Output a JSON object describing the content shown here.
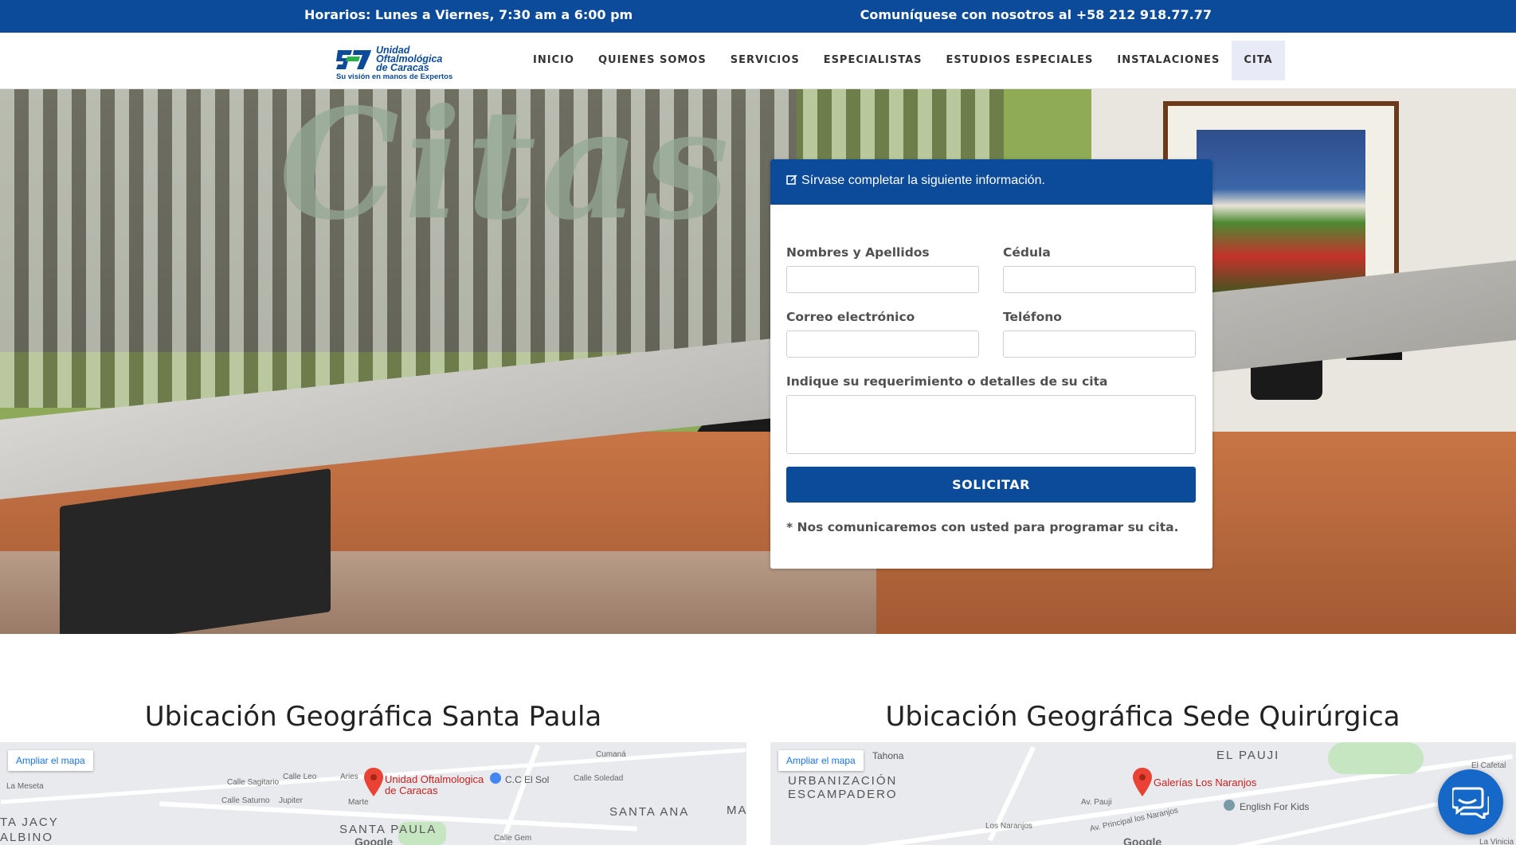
{
  "topbar": {
    "hours": "Horarios: Lunes a Viernes, 7:30 am a 6:00 pm",
    "contact": "Comuníquese con nosotros al +58 212 918.77.77"
  },
  "logo": {
    "line1": "Unidad",
    "line2": "Oftalmológica",
    "line3": "de Caracas",
    "tagline": "Su visión en manos de Expertos"
  },
  "nav": {
    "items": [
      {
        "label": "INICIO"
      },
      {
        "label": "QUIENES SOMOS"
      },
      {
        "label": "SERVICIOS"
      },
      {
        "label": "ESPECIALISTAS"
      },
      {
        "label": "ESTUDIOS ESPECIALES"
      },
      {
        "label": "INSTALACIONES"
      },
      {
        "label": "CITA",
        "active": true
      }
    ]
  },
  "hero": {
    "sign_text": "Citas"
  },
  "form": {
    "header": "Sírvase completar la siguiente información.",
    "name_label": "Nombres y Apellidos",
    "name_value": "",
    "id_label": "Cédula",
    "id_value": "",
    "email_label": "Correo electrónico",
    "email_value": "",
    "phone_label": "Teléfono",
    "phone_value": "",
    "details_label": "Indique su requerimiento o detalles de su cita",
    "details_value": "",
    "submit_label": "SOLICITAR",
    "note": "* Nos comunicaremos con usted para programar su cita."
  },
  "locations": [
    {
      "title": "Ubicación Geográfica Santa Paula",
      "enlarge_label": "Ampliar el mapa",
      "place_label": "Unidad Oftalmologica de Caracas",
      "poi": "C.C El Sol",
      "areas": [
        "SANTA PAULA",
        "SANTA ANA",
        "TA JACY",
        "ALBINO",
        "MA"
      ],
      "streets": [
        "La Meseta",
        "Calle Sagitario",
        "Calle Saturno",
        "Jupiter",
        "Calle Leo",
        "Aries",
        "Marte",
        "Calle Soledad",
        "Cumaná",
        "Calle Gem"
      ],
      "google": "Google"
    },
    {
      "title": "Ubicación Geográfica Sede Quirúrgica",
      "enlarge_label": "Ampliar el mapa",
      "place_label": "Galerías Los Naranjos",
      "poi": "English For Kids",
      "poi2": "Tahona",
      "areas": [
        "URBANIZACIÓN",
        "ESCAMPADERO",
        "EL PAUJI"
      ],
      "streets": [
        "Los Naranjos",
        "Av. Principal los Naranjos",
        "Av. Pauji",
        "El Cafetal",
        "La Vinicia"
      ],
      "google": "Google"
    }
  ],
  "colors": {
    "brand_blue": "#0c4a9a",
    "map_bg": "#e8eaed",
    "pin_red": "#ea4335"
  },
  "icons": {
    "form_header": "edit-icon",
    "chat": "chat-bubbles-icon",
    "map_pin": "map-pin-icon"
  }
}
